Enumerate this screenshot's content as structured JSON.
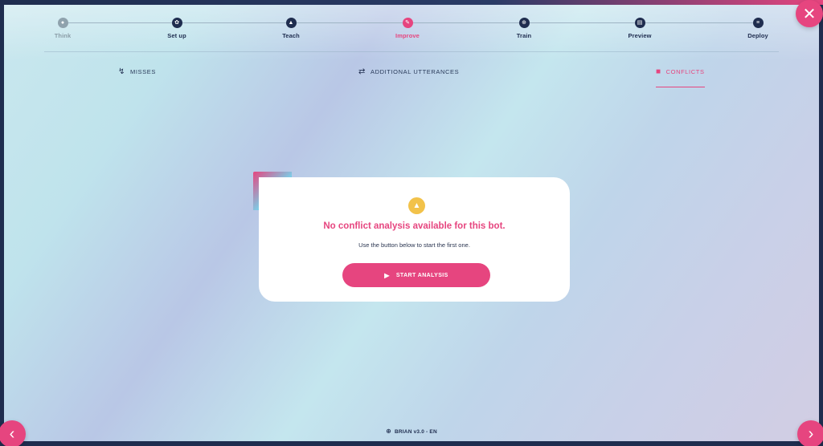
{
  "stepper": {
    "steps": [
      {
        "label": "Think",
        "state": "done",
        "icon": "bulb-icon"
      },
      {
        "label": "Set up",
        "state": "todo",
        "icon": "gear-icon"
      },
      {
        "label": "Teach",
        "state": "todo",
        "icon": "graduation-cap-icon"
      },
      {
        "label": "Improve",
        "state": "active",
        "icon": "pencil-icon"
      },
      {
        "label": "Train",
        "state": "todo",
        "icon": "dumbbell-icon"
      },
      {
        "label": "Preview",
        "state": "todo",
        "icon": "chat-icon"
      },
      {
        "label": "Deploy",
        "state": "todo",
        "icon": "list-icon"
      }
    ]
  },
  "tabs": {
    "misses": "MISSES",
    "additional_utterances": "ADDITIONAL UTTERANCES",
    "conflicts": "CONFLICTS",
    "active": "conflicts"
  },
  "card": {
    "title": "No conflict analysis available for this bot.",
    "subtitle": "Use the button below to start the first one.",
    "button_label": "START ANALYSIS"
  },
  "footer": {
    "version": "BRIAN v3.0 - EN"
  },
  "colors": {
    "accent": "#e6457f",
    "navy": "#1f2d4f",
    "warning": "#f2c24a",
    "cyan": "#62c6e8"
  }
}
